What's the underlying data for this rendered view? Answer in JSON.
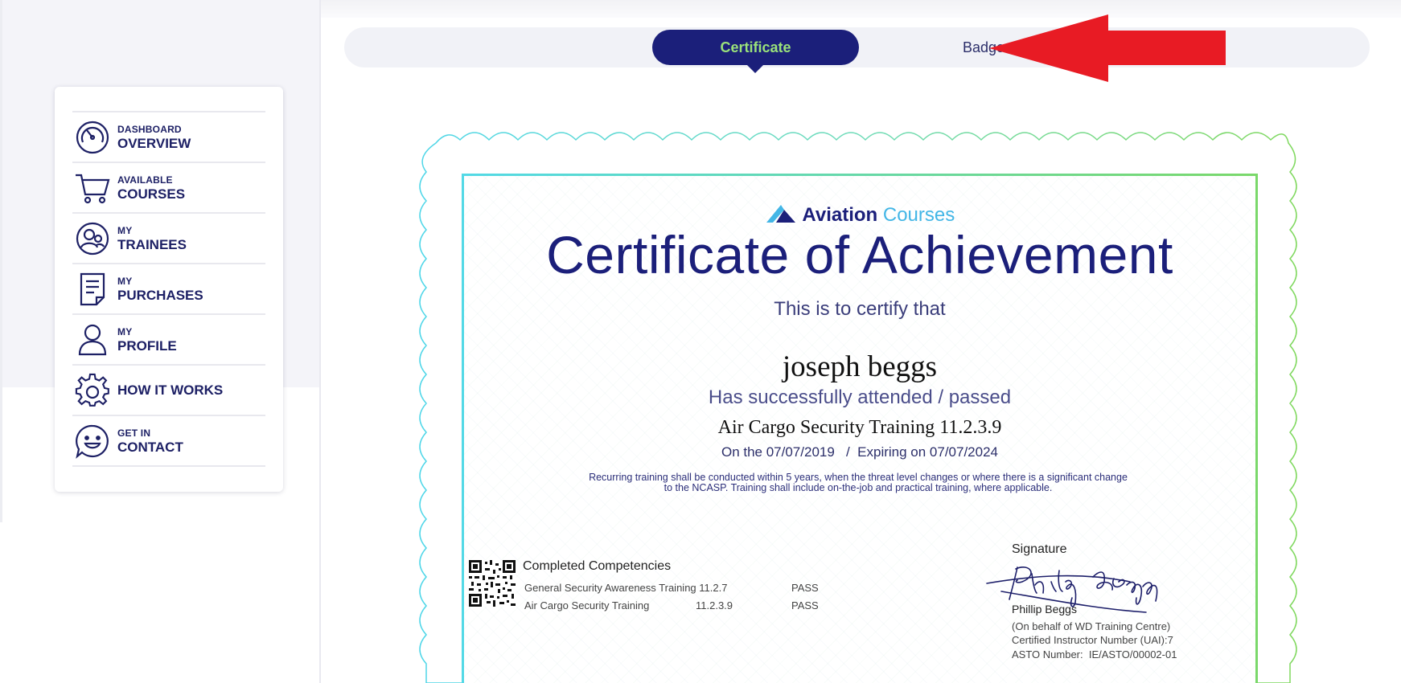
{
  "sidebar": {
    "items": [
      {
        "small": "DASHBOARD",
        "label": "OVERVIEW",
        "icon": "speedometer-icon"
      },
      {
        "small": "AVAILABLE",
        "label": "COURSES",
        "icon": "cart-icon"
      },
      {
        "small": "MY",
        "label": "TRAINEES",
        "icon": "users-icon"
      },
      {
        "small": "MY",
        "label": "PURCHASES",
        "icon": "document-icon"
      },
      {
        "small": "MY",
        "label": "PROFILE",
        "icon": "user-icon"
      },
      {
        "small": "",
        "label": "HOW IT WORKS",
        "icon": "gear-icon"
      },
      {
        "small": "GET IN",
        "label": "CONTACT",
        "icon": "smiley-chat-icon"
      }
    ]
  },
  "tabs": {
    "certificate": "Certificate",
    "badge": "Badge",
    "active": "certificate"
  },
  "colors": {
    "navy": "#1b1f7a",
    "active_tab_text": "#9ae27a",
    "arrow": "#e81b24"
  },
  "certificate": {
    "logo_main": "Aviation",
    "logo_accent": "Courses",
    "title": "Certificate of Achievement",
    "certify_text": "This is to certify that",
    "recipient": "joseph beggs",
    "attended_text": "Has successfully attended / passed",
    "course": "Air Cargo Security Training 11.2.3.9",
    "dates": "On the 07/07/2019   /  Expiring on 07/07/2024",
    "note_line1": "Recurring training shall be conducted within 5 years, when the threat level changes or where there is a significant change",
    "note_line2": "to the NCASP. Training shall include on-the-job and practical training, where applicable.",
    "competencies_title": "Completed Competencies",
    "competencies": [
      {
        "name": "General Security Awareness Training 11.2.7",
        "code": "",
        "result": "PASS"
      },
      {
        "name": "Air Cargo Security Training",
        "code": "11.2.3.9",
        "result": "PASS"
      }
    ],
    "signature_label": "Signature",
    "signer_name": "Phillip Beggs",
    "signer_line1": "(On behalf of WD Training Centre)",
    "signer_line2": "Certified Instructor Number (UAI):7",
    "signer_line3": "ASTO Number:  IE/ASTO/00002-01"
  }
}
